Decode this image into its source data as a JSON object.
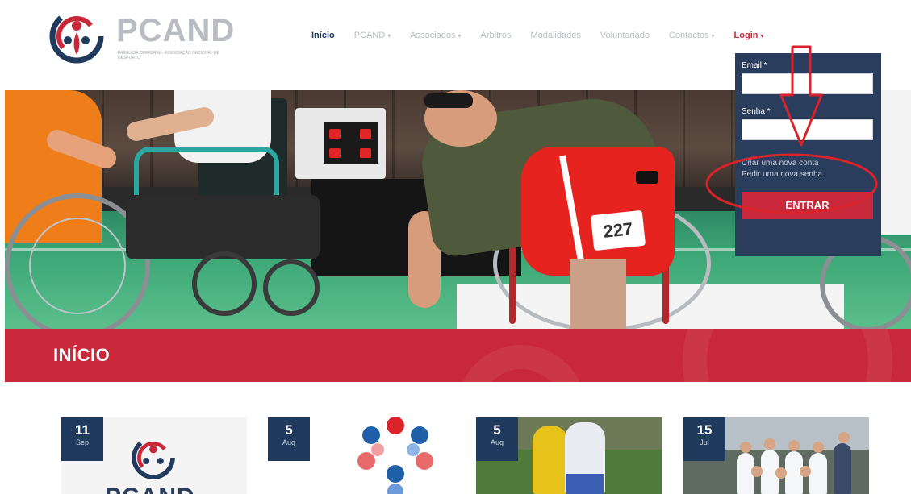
{
  "brand": {
    "name": "PCAND",
    "tagline": "Paralisia Cerebral - Associação Nacional de Desporto",
    "colors": {
      "navy": "#1f3a5c",
      "red": "#c8283a",
      "gray": "#b9bcc2"
    }
  },
  "nav": {
    "items": [
      {
        "label": "Início",
        "active": true,
        "has_caret": false
      },
      {
        "label": "PCAND",
        "active": false,
        "has_caret": true
      },
      {
        "label": "Associados",
        "active": false,
        "has_caret": true
      },
      {
        "label": "Árbitros",
        "active": false,
        "has_caret": false
      },
      {
        "label": "Modalidades",
        "active": false,
        "has_caret": false
      },
      {
        "label": "Voluntariado",
        "active": false,
        "has_caret": false
      },
      {
        "label": "Contactos",
        "active": false,
        "has_caret": true
      }
    ],
    "login": {
      "label": "Login",
      "caret": "▾"
    }
  },
  "login_dropdown": {
    "email_label": "Email *",
    "email_value": "",
    "password_label": "Senha *",
    "password_value": "",
    "create_account_link": "Criar uma nova conta",
    "forgot_password_link": "Pedir uma nova senha",
    "submit_label": "ENTRAR"
  },
  "hero": {
    "bib_number": "227"
  },
  "page": {
    "title": "INÍCIO"
  },
  "news": [
    {
      "day": "11",
      "month": "Sep",
      "image": "pcand-logo",
      "image_text": "PCAND"
    },
    {
      "day": "5",
      "month": "Aug",
      "image": "asterisk-logo"
    },
    {
      "day": "5",
      "month": "Aug",
      "image": "football-photo"
    },
    {
      "day": "15",
      "month": "Jul",
      "image": "team-photo"
    }
  ]
}
